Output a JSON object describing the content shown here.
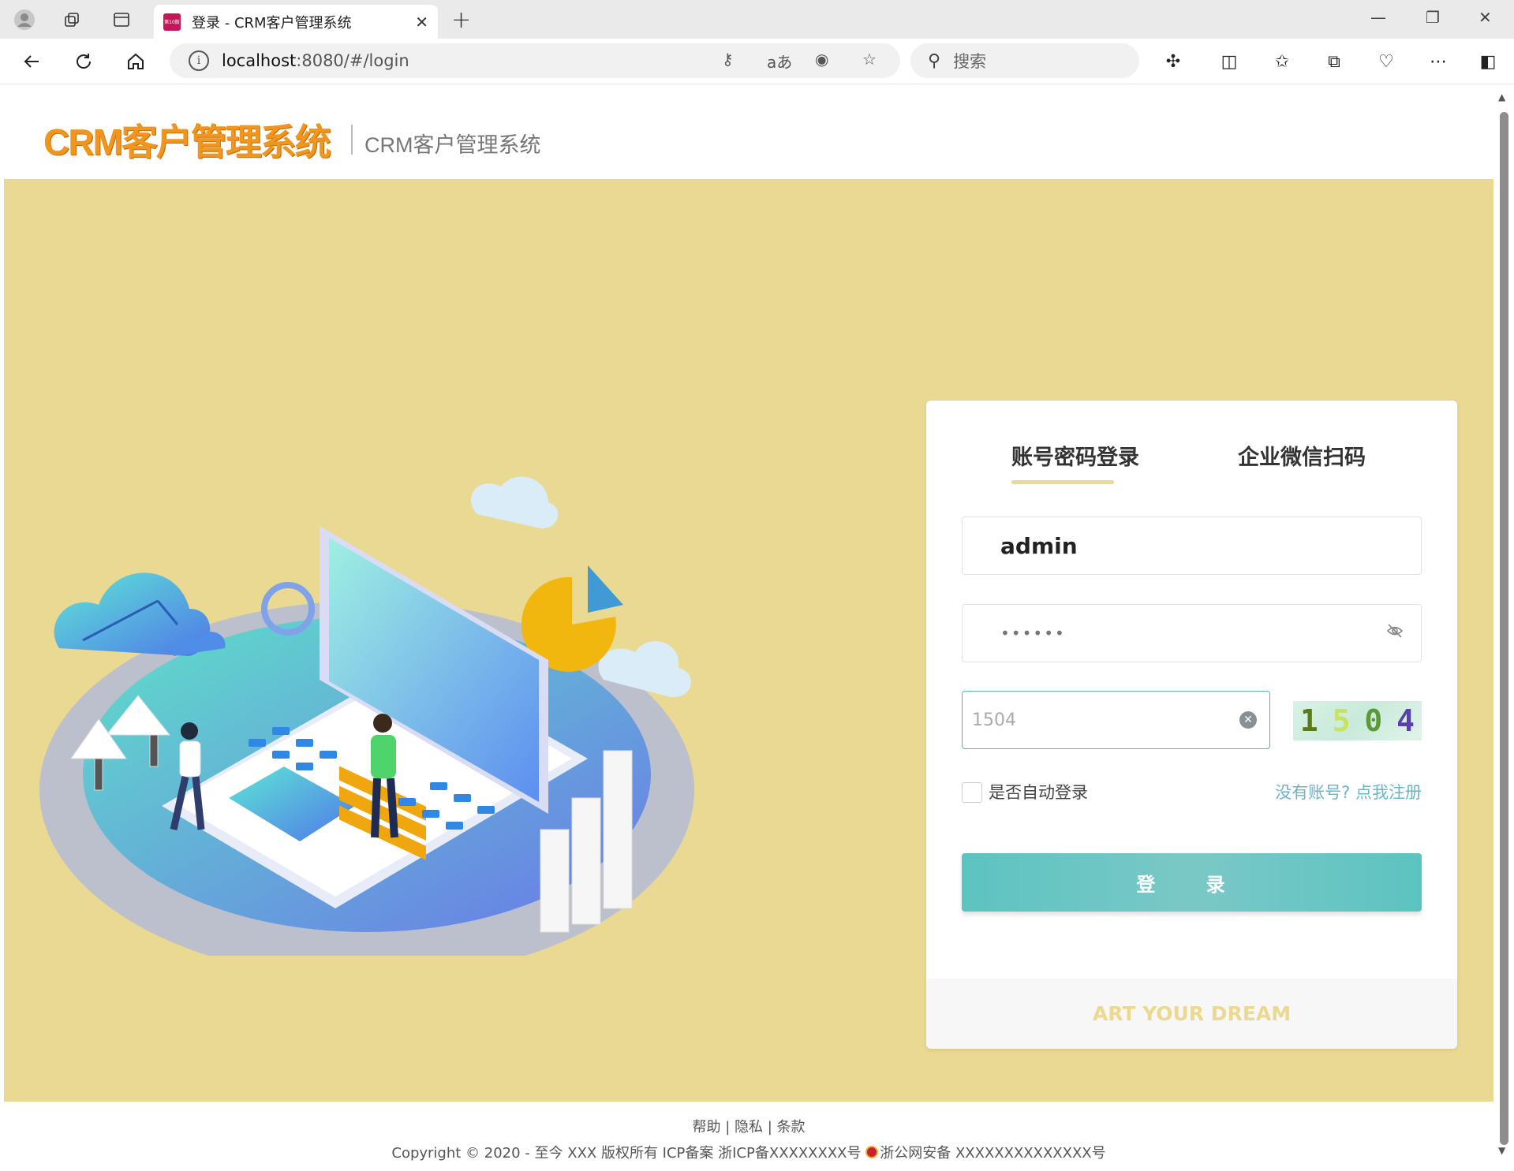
{
  "browser": {
    "tab_title": "登录 - CRM客户管理系统",
    "favicon_text": "第10版",
    "url_host": "localhost",
    "url_path": ":8080/#/login",
    "search_placeholder": "搜索"
  },
  "header": {
    "logo_text": "CRM客户管理系统",
    "subtitle": "CRM客户管理系统"
  },
  "login": {
    "tabs": [
      "账号密码登录",
      "企业微信扫码"
    ],
    "active_tab": 0,
    "username_value": "admin",
    "password_masked": "••••••",
    "captcha_input_value": "1504",
    "captcha_image_text": [
      "1",
      "5",
      "0",
      "4"
    ],
    "auto_login_label": "是否自动登录",
    "auto_login_checked": false,
    "register_link": "没有账号? 点我注册",
    "login_button": "登 录",
    "slogan": "ART YOUR DREAM"
  },
  "footer": {
    "links_line": "帮助 | 隐私 | 条款",
    "copyright_line_a": "Copyright © 2020 - 至今 XXX 版权所有 ICP备案 浙ICP备XXXXXXXX号",
    "copyright_line_b": "浙公网安备 XXXXXXXXXXXXXX号"
  },
  "colors": {
    "background": "#e9d992",
    "accent_teal": "#5cc4c0",
    "logo_orange": "#f0961e"
  }
}
